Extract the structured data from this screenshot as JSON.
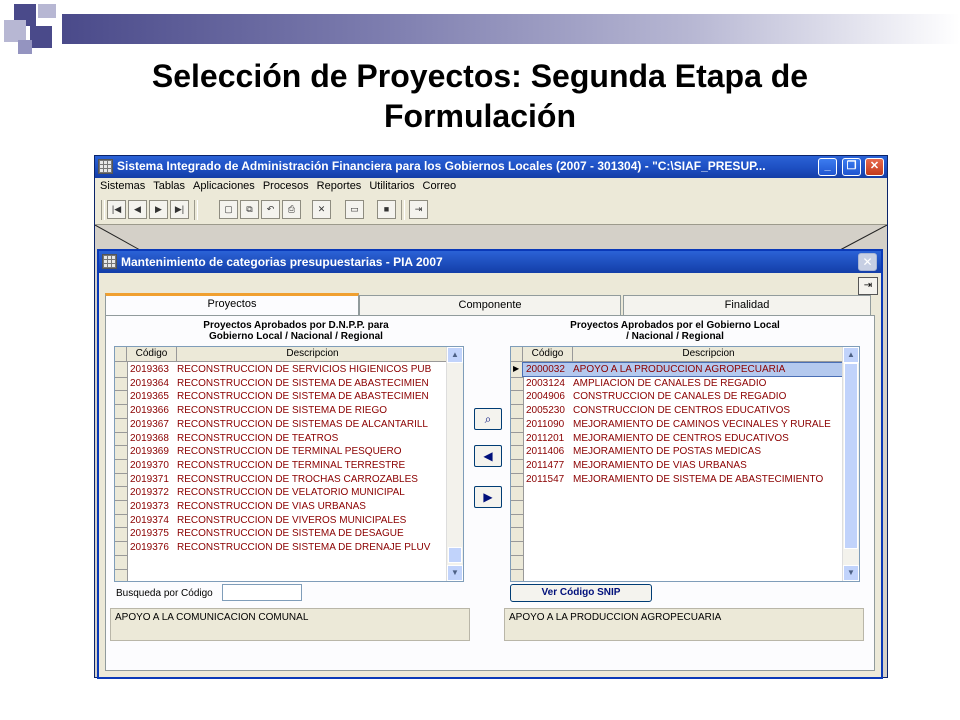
{
  "slide": {
    "title_line1": "Selección de Proyectos: Segunda Etapa de",
    "title_line2": "Formulación"
  },
  "app": {
    "title": "Sistema Integrado de Administración Financiera para los Gobiernos Locales (2007 - 301304) - \"C:\\SIAF_PRESUP...",
    "menu": [
      "Sistemas",
      "Tablas",
      "Aplicaciones",
      "Procesos",
      "Reportes",
      "Utilitarios",
      "Correo"
    ]
  },
  "dialog": {
    "title": "Mantenimiento de categorias presupuestarias - PIA 2007",
    "tabs": [
      "Proyectos",
      "Componente",
      "Finalidad"
    ],
    "left": {
      "title_line1": "Proyectos Aprobados por D.N.P.P. para",
      "title_line2": "Gobierno Local / Nacional / Regional",
      "col_code": "Código",
      "col_desc": "Descripcion",
      "rows": [
        {
          "code": "2019363",
          "desc": "RECONSTRUCCION DE SERVICIOS HIGIENICOS PUB"
        },
        {
          "code": "2019364",
          "desc": "RECONSTRUCCION DE SISTEMA DE ABASTECIMIEN"
        },
        {
          "code": "2019365",
          "desc": "RECONSTRUCCION DE SISTEMA DE ABASTECIMIEN"
        },
        {
          "code": "2019366",
          "desc": "RECONSTRUCCION DE SISTEMA DE RIEGO"
        },
        {
          "code": "2019367",
          "desc": "RECONSTRUCCION DE SISTEMAS DE ALCANTARILL"
        },
        {
          "code": "2019368",
          "desc": "RECONSTRUCCION DE TEATROS"
        },
        {
          "code": "2019369",
          "desc": "RECONSTRUCCION DE TERMINAL PESQUERO"
        },
        {
          "code": "2019370",
          "desc": "RECONSTRUCCION DE TERMINAL TERRESTRE"
        },
        {
          "code": "2019371",
          "desc": "RECONSTRUCCION DE TROCHAS CARROZABLES"
        },
        {
          "code": "2019372",
          "desc": "RECONSTRUCCION DE VELATORIO MUNICIPAL"
        },
        {
          "code": "2019373",
          "desc": "RECONSTRUCCION DE VIAS URBANAS"
        },
        {
          "code": "2019374",
          "desc": "RECONSTRUCCION DE VIVEROS MUNICIPALES"
        },
        {
          "code": "2019375",
          "desc": "RECONSTRUCCION DE SISTEMA DE DESAGUE"
        },
        {
          "code": "2019376",
          "desc": "RECONSTRUCCION DE SISTEMA DE DRENAJE PLUV"
        }
      ],
      "search_label": "Busqueda por Código",
      "search_value": "",
      "memo": "APOYO A LA COMUNICACION COMUNAL"
    },
    "right": {
      "title_line1": "Proyectos Aprobados por el Gobierno Local",
      "title_line2": "/ Nacional / Regional",
      "col_code": "Código",
      "col_desc": "Descripcion",
      "rows": [
        {
          "code": "2000032",
          "desc": "APOYO A LA PRODUCCION AGROPECUARIA"
        },
        {
          "code": "2003124",
          "desc": "AMPLIACION DE CANALES DE REGADIO"
        },
        {
          "code": "2004906",
          "desc": "CONSTRUCCION DE CANALES DE REGADIO"
        },
        {
          "code": "2005230",
          "desc": "CONSTRUCCION DE CENTROS EDUCATIVOS"
        },
        {
          "code": "2011090",
          "desc": "MEJORAMIENTO DE CAMINOS VECINALES Y RURALE"
        },
        {
          "code": "2011201",
          "desc": "MEJORAMIENTO DE CENTROS EDUCATIVOS"
        },
        {
          "code": "2011406",
          "desc": "MEJORAMIENTO DE POSTAS MEDICAS"
        },
        {
          "code": "2011477",
          "desc": "MEJORAMIENTO DE VIAS URBANAS"
        },
        {
          "code": "2011547",
          "desc": "MEJORAMIENTO DE SISTEMA DE ABASTECIMIENTO"
        }
      ],
      "snip_button": "Ver Código SNIP",
      "memo": "APOYO A LA PRODUCCION AGROPECUARIA"
    }
  }
}
